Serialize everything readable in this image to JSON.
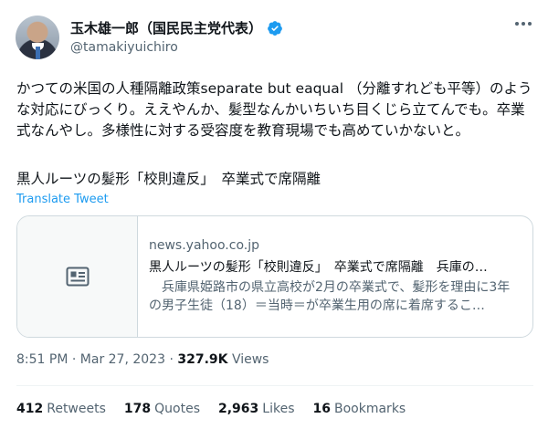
{
  "author": {
    "display_name": "玉木雄一郎（国民民主党代表）",
    "handle": "@tamakiyuichiro"
  },
  "tweet": {
    "text": "かつての米国の人種隔離政策separate but eaqual （分離すれども平等）のような対応にびっくり。ええやんか、髪型なんかいちいち目くじら立てんでも。卒業式なんやし。多様性に対する受容度を教育現場でも高めていかないと。",
    "headline": "黒人ルーツの髪形「校則違反」　卒業式で席隔離",
    "translate_label": "Translate Tweet"
  },
  "link_card": {
    "domain": "news.yahoo.co.jp",
    "title": "黒人ルーツの髪形「校則違反」　卒業式で席隔離　兵庫の…",
    "description": "　兵庫県姫路市の県立高校が2月の卒業式で、髪形を理由に3年の男子生徒（18）＝当時＝が卒業生用の席に着席するこ…"
  },
  "meta": {
    "time": "8:51 PM",
    "sep1": "·",
    "date": "Mar 27, 2023",
    "sep2": "·",
    "views_count": "327.9K",
    "views_label": "Views"
  },
  "stats": {
    "retweets_count": "412",
    "retweets_label": "Retweets",
    "quotes_count": "178",
    "quotes_label": "Quotes",
    "likes_count": "2,963",
    "likes_label": "Likes",
    "bookmarks_count": "16",
    "bookmarks_label": "Bookmarks"
  },
  "colors": {
    "link": "#1d9bf0",
    "verified": "#1d9bf0",
    "secondary_text": "#536471",
    "border": "#cfd9de"
  },
  "icons": {
    "verified": "verified-badge-icon",
    "more": "more-icon",
    "card_thumb": "article-icon"
  }
}
